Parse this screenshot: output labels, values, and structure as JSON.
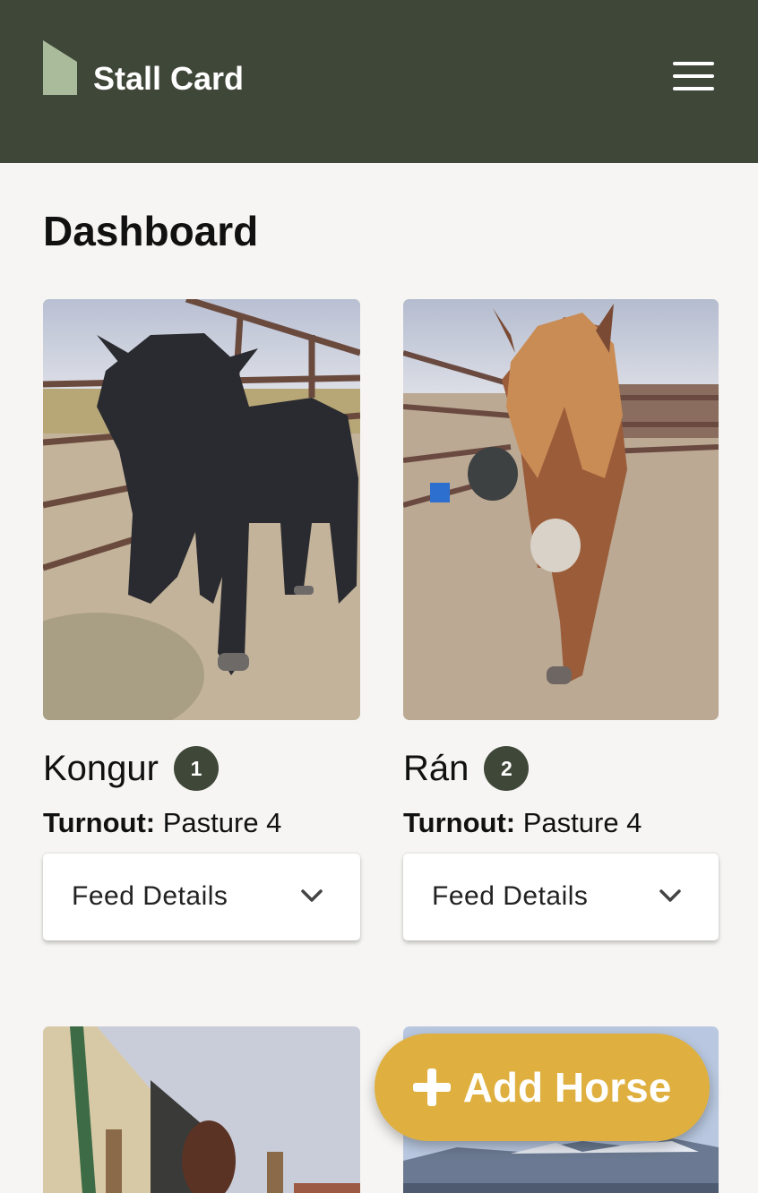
{
  "app": {
    "title": "Stall Card",
    "logo_icon": "stall-card-logo-icon",
    "menu_icon": "hamburger-menu-icon"
  },
  "page": {
    "title": "Dashboard"
  },
  "horses": [
    {
      "name": "Kongur",
      "stall_number": "1",
      "turnout_label": "Turnout:",
      "turnout_value": "Pasture 4",
      "feed_label": "Feed Details"
    },
    {
      "name": "Rán",
      "stall_number": "2",
      "turnout_label": "Turnout:",
      "turnout_value": "Pasture 4",
      "feed_label": "Feed Details"
    },
    {
      "name": "",
      "stall_number": "",
      "turnout_label": "",
      "turnout_value": "",
      "feed_label": ""
    },
    {
      "name": "",
      "stall_number": "",
      "turnout_label": "",
      "turnout_value": "",
      "feed_label": ""
    }
  ],
  "fab": {
    "label": "Add Horse",
    "icon": "plus-icon"
  },
  "colors": {
    "header": "#3f4739",
    "logo": "#a9bb9b",
    "background": "#f6f5f3",
    "badge": "#3f4739",
    "fab": "#dfb03f"
  }
}
